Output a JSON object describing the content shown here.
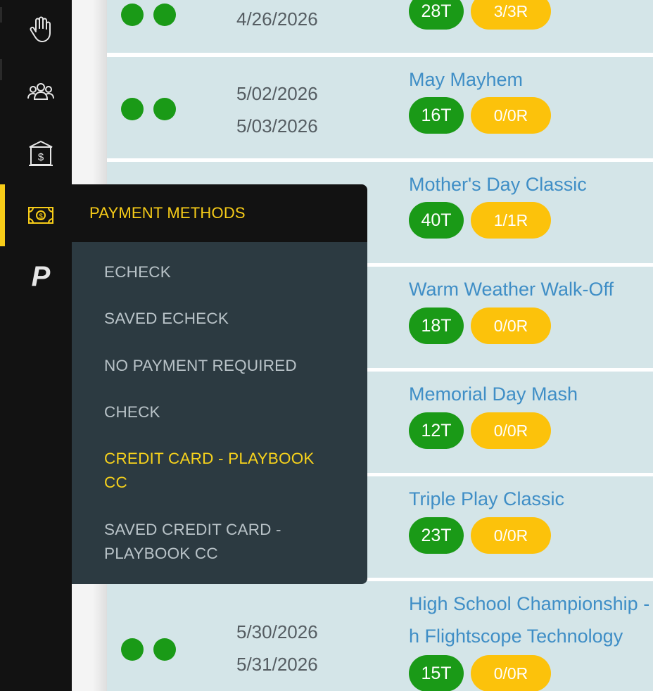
{
  "sidebar": {
    "icons": [
      {
        "name": "hand-icon"
      },
      {
        "name": "users-icon"
      },
      {
        "name": "bank-icon"
      },
      {
        "name": "money-icon",
        "active": true
      },
      {
        "name": "playbook-logo-icon",
        "glyph": "P"
      }
    ]
  },
  "flyout": {
    "title": "PAYMENT METHODS",
    "items": [
      {
        "label": "ECHECK"
      },
      {
        "label": "SAVED ECHECK"
      },
      {
        "label": "NO PAYMENT REQUIRED"
      },
      {
        "label": "CHECK"
      },
      {
        "label": "CREDIT CARD - PLAYBOOK CC",
        "active": true
      },
      {
        "label": "SAVED CREDIT CARD - PLAYBOOK CC"
      }
    ]
  },
  "events": [
    {
      "start": "",
      "end": "4/26/2026",
      "title": "",
      "teams": "28T",
      "registrations": "3/3R"
    },
    {
      "start": "5/02/2026",
      "end": "5/03/2026",
      "title": "May Mayhem",
      "teams": "16T",
      "registrations": "0/0R"
    },
    {
      "title": "Mother's Day Classic",
      "teams": "40T",
      "registrations": "1/1R"
    },
    {
      "title": "Warm Weather Walk-Off",
      "teams": "18T",
      "registrations": "0/0R"
    },
    {
      "title": "Memorial Day Mash",
      "teams": "12T",
      "registrations": "0/0R"
    },
    {
      "title": "Triple Play Classic",
      "teams": "23T",
      "registrations": "0/0R"
    },
    {
      "start": "5/30/2026",
      "end": "5/31/2026",
      "title": "High School Championship -",
      "title_line2": "h Flightscope Technology",
      "teams": "15T",
      "registrations": "0/0R"
    }
  ],
  "colors": {
    "accent": "#f7cc18",
    "status_green": "#1a9a17",
    "badge_yellow": "#fcc20b",
    "link_blue": "#3f8ec6",
    "row_bg": "#d4e5e8",
    "sidebar_bg": "#121212",
    "flyout_bg": "#2c3a41"
  }
}
